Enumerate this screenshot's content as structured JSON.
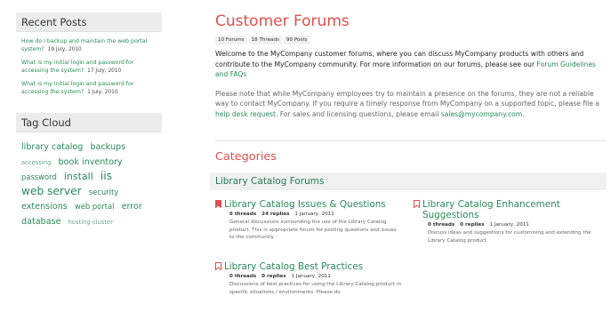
{
  "sidebar": {
    "recent_title": "Recent Posts",
    "recent_posts": [
      {
        "title": "How do I backup and maintain the web portal system?",
        "date": "19 July, 2010"
      },
      {
        "title": "What is my initial login and password for accessing the system?",
        "date": "17 July, 2010"
      },
      {
        "title": "What is my initial login and password for accessing the system?",
        "date": "1 July, 2010"
      }
    ],
    "tag_title": "Tag Cloud",
    "tags": [
      {
        "text": "library catalog",
        "size": 3
      },
      {
        "text": "backups",
        "size": 3
      },
      {
        "text": "accessing",
        "size": 1
      },
      {
        "text": "book inventory",
        "size": 3
      },
      {
        "text": "password",
        "size": 2
      },
      {
        "text": "install",
        "size": 4
      },
      {
        "text": "iis",
        "size": 5
      },
      {
        "text": "web server",
        "size": 5
      },
      {
        "text": "security",
        "size": 2
      },
      {
        "text": "extensions",
        "size": 3
      },
      {
        "text": "web portal",
        "size": 2
      },
      {
        "text": "error",
        "size": 3
      },
      {
        "text": "database",
        "size": 3
      },
      {
        "text": "hosting cluster",
        "size": 1
      }
    ]
  },
  "main": {
    "title": "Customer Forums",
    "stats": [
      "10 Forums",
      "18 Threads",
      "90 Posts"
    ],
    "intro": {
      "text": "Welcome to the MyCompany customer forums, where you can discuss MyCompany products with others and contribute to the MyCompany community. For more information on our forums, please see our ",
      "link": "Forum Guidelines and FAQs"
    },
    "notice": {
      "text1": "Please note that while MyCompany employees try to maintain a presence on the forums, they are not a reliable way to contact MyCompany. If you require a timely response from MyCompany on a supported topic, please file a ",
      "link1": "help desk request",
      "text2": ". For sales and licensing questions, please email ",
      "link2": "sales@mycompany.com",
      "text3": "."
    },
    "categories_title": "Categories",
    "category": "Library Catalog Forums",
    "forums": [
      {
        "title": "Library Catalog Issues & Questions",
        "threads": "6 threads",
        "replies": "24 replies",
        "date": "1 January, 2011",
        "desc": "General discussions surrounding the use of the Library Catalog product. This is appropriate forum for posting questions and issues to the community.",
        "active": true
      },
      {
        "title": "Library Catalog Enhancement Suggestions",
        "threads": "0 threads",
        "replies": "0 replies",
        "date": "1 January, 2011",
        "desc": "Discuss ideas and suggestions for customising and extending the Library Catalog product.",
        "active": false
      },
      {
        "title": "Library Catalog Best Practices",
        "threads": "0 threads",
        "replies": "0 replies",
        "date": "1 January, 2011",
        "desc": "Discussions of best practices for using the Library Catalog product in specific situations / environments. Please do",
        "active": false
      }
    ],
    "colors": {
      "accent": "#e04e4e",
      "link": "#2a8a5a",
      "bookmark_active": "#e04e4e",
      "bookmark_inactive": "#e04e4e"
    }
  }
}
